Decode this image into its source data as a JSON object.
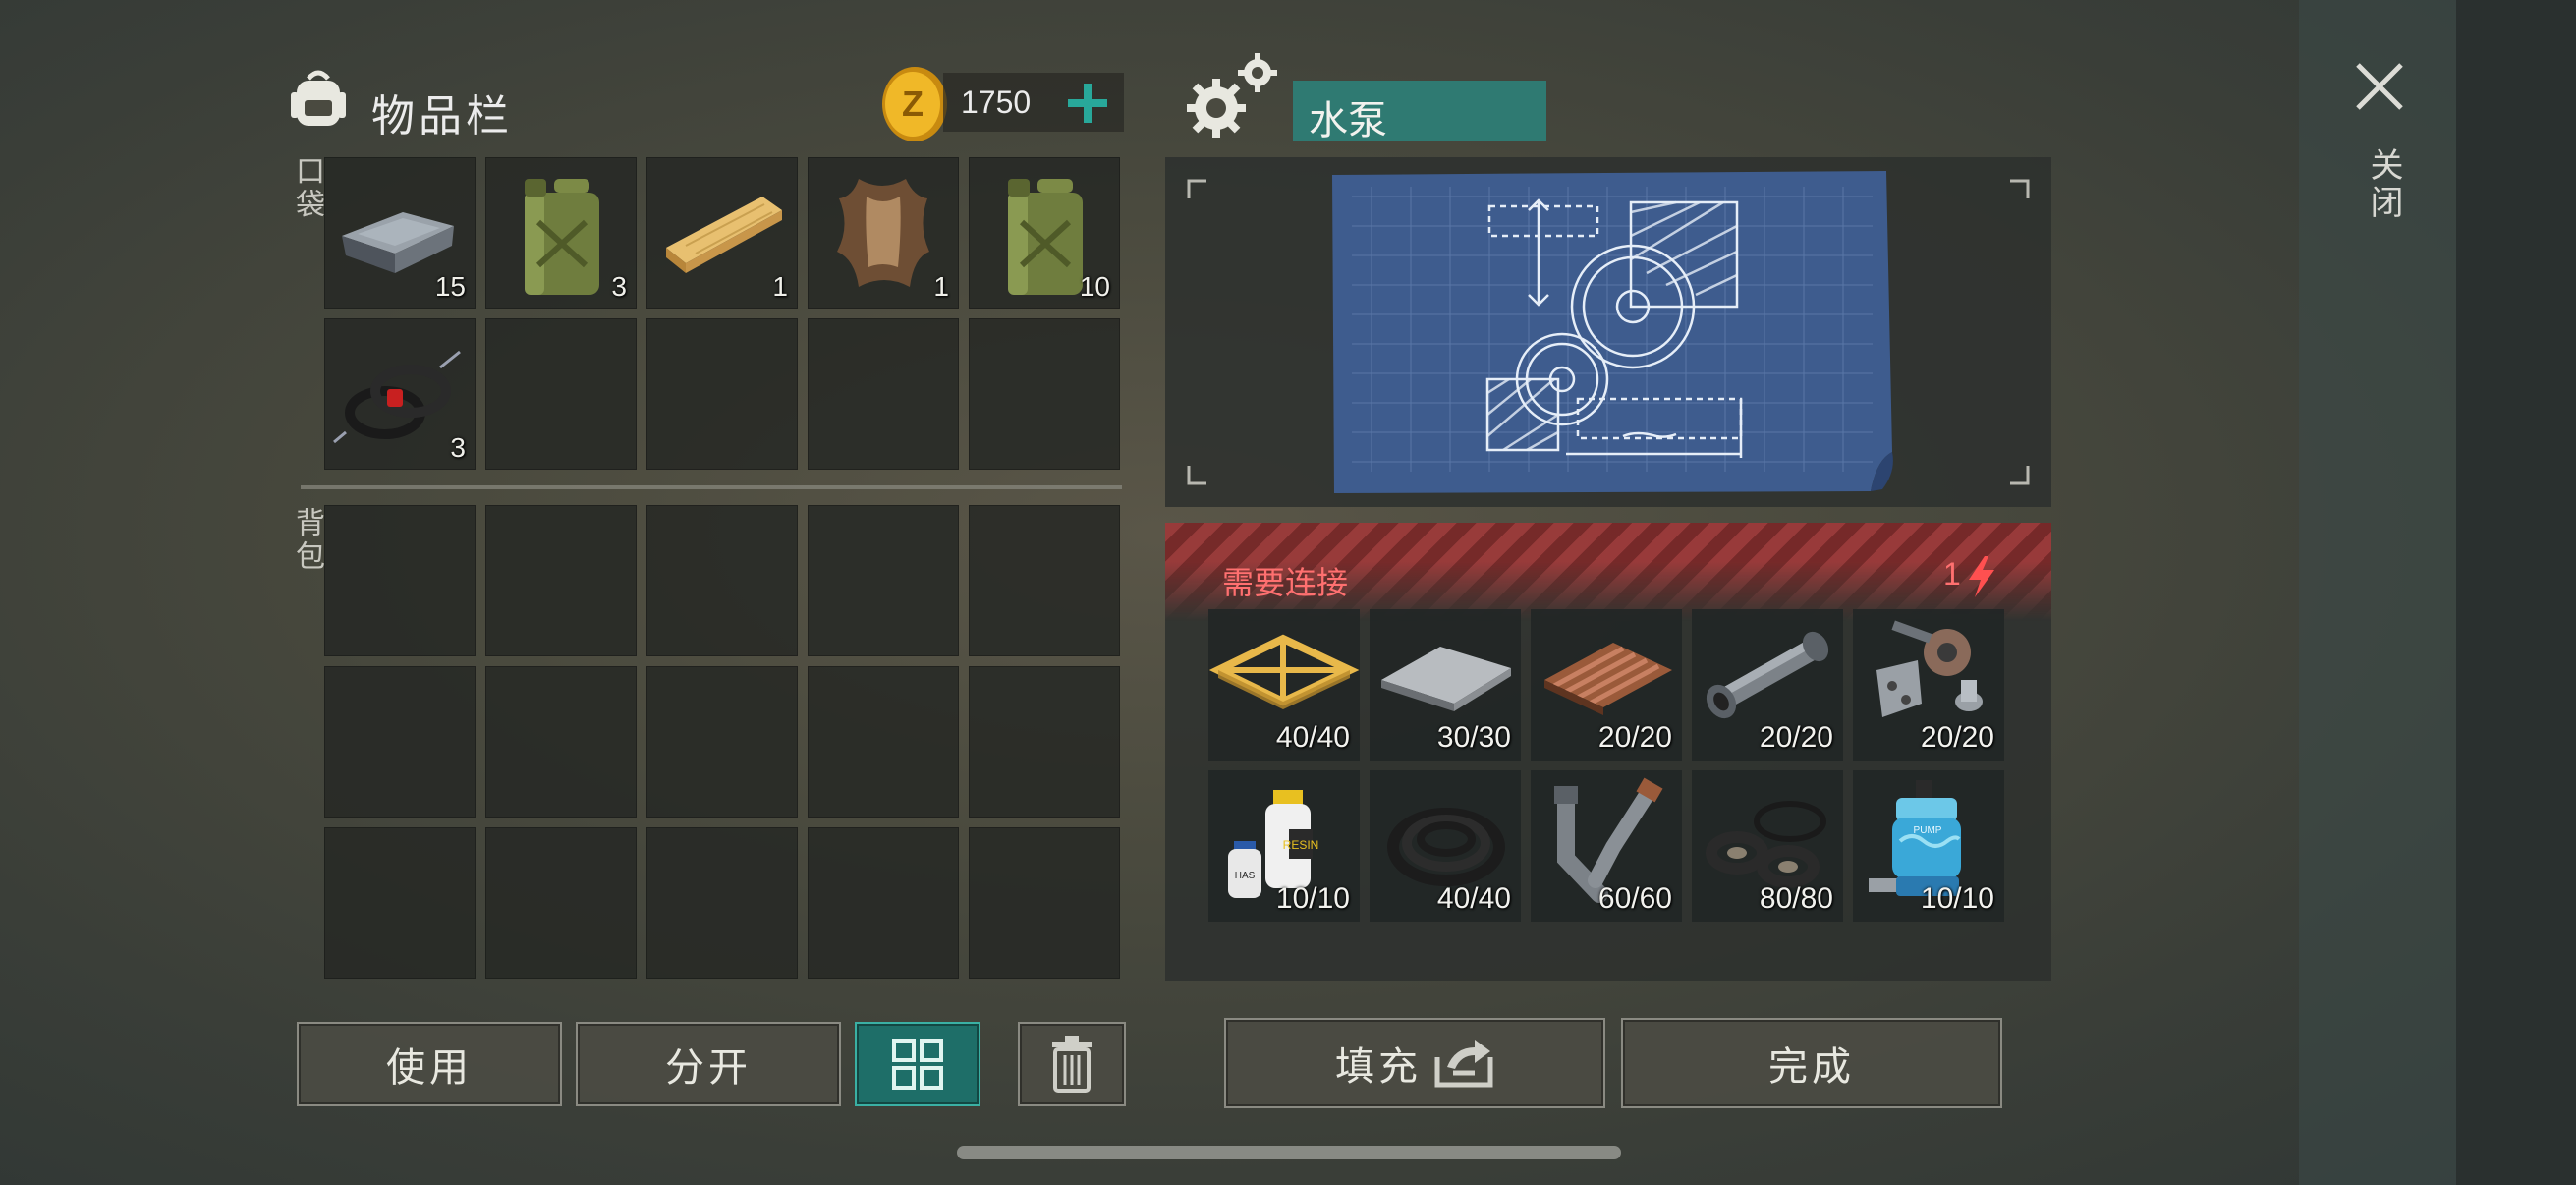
{
  "inventory": {
    "title": "物品栏",
    "coins": "1750",
    "pocket_label": "口袋",
    "backpack_label": "背包",
    "pocket_items": [
      {
        "icon": "iron-ingot-icon",
        "count": "15"
      },
      {
        "icon": "jerrycan-icon",
        "count": "3"
      },
      {
        "icon": "wood-plank-icon",
        "count": "1"
      },
      {
        "icon": "animal-hide-icon",
        "count": "1"
      },
      {
        "icon": "jerrycan-icon",
        "count": "10"
      },
      {
        "icon": "rope-coil-icon",
        "count": "3"
      }
    ]
  },
  "actions": {
    "use": "使用",
    "split": "分开"
  },
  "craft": {
    "title": "水泵",
    "warning": "需要连接",
    "power": "1",
    "materials": [
      {
        "icon": "wooden-frame-icon",
        "count": "40/40"
      },
      {
        "icon": "metal-sheet-icon",
        "count": "30/30"
      },
      {
        "icon": "corrugated-sheet-icon",
        "count": "20/20"
      },
      {
        "icon": "metal-pipe-icon",
        "count": "20/20"
      },
      {
        "icon": "mechanical-parts-icon",
        "count": "20/20"
      },
      {
        "icon": "resin-bottles-icon",
        "count": "10/10"
      },
      {
        "icon": "rubber-hose-icon",
        "count": "40/40"
      },
      {
        "icon": "pipe-fittings-icon",
        "count": "60/60"
      },
      {
        "icon": "rubber-gaskets-icon",
        "count": "80/80"
      },
      {
        "icon": "pump-motor-icon",
        "count": "10/10"
      }
    ],
    "fill_label": "填充",
    "done_label": "完成"
  },
  "close_label": "关闭",
  "colors": {
    "accent_teal": "#2a8a80",
    "warning_red": "#ff6a6a",
    "coin_gold": "#e5a81c"
  }
}
